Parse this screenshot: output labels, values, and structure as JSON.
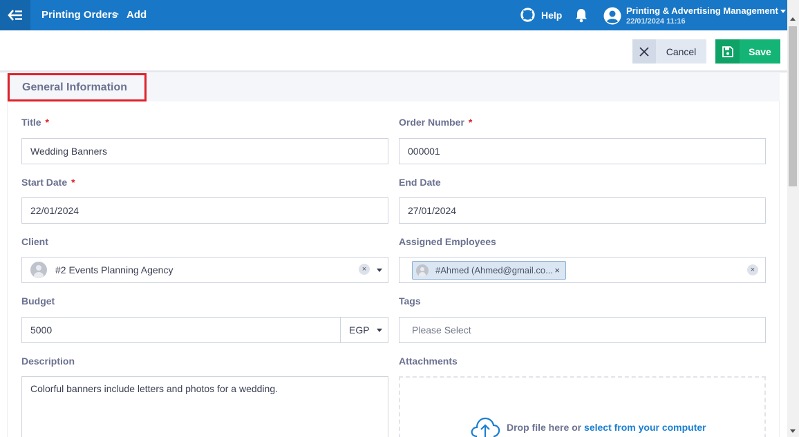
{
  "header": {
    "breadcrumb": [
      "Printing Orders",
      "Add"
    ],
    "breadcrumb_separator": ">",
    "help_label": "Help",
    "user_name": "Printing & Advertising Management",
    "user_datetime": "22/01/2024 11:16"
  },
  "actions": {
    "cancel_label": "Cancel",
    "save_label": "Save"
  },
  "section": {
    "title": "General Information"
  },
  "form": {
    "required_mark": "*",
    "title": {
      "label": "Title",
      "value": "Wedding Banners"
    },
    "order_number": {
      "label": "Order Number",
      "value": "000001"
    },
    "start_date": {
      "label": "Start Date",
      "value": "22/01/2024"
    },
    "end_date": {
      "label": "End Date",
      "value": "27/01/2024"
    },
    "client": {
      "label": "Client",
      "value": "#2 Events Planning Agency"
    },
    "assigned_employees": {
      "label": "Assigned Employees",
      "chips": [
        "#Ahmed (Ahmed@gmail.co..."
      ]
    },
    "budget": {
      "label": "Budget",
      "value": "5000",
      "currency": "EGP"
    },
    "tags": {
      "label": "Tags",
      "placeholder": "Please Select"
    },
    "description": {
      "label": "Description",
      "value": "Colorful banners include letters and photos for a wedding."
    },
    "attachments": {
      "label": "Attachments",
      "drop_text": "Drop file here or",
      "drop_link": "select from your computer"
    }
  },
  "colors": {
    "topbar": "#1877c6",
    "save": "#13b475",
    "required": "#e0202a",
    "link": "#1a7fd1"
  },
  "icons": [
    "back-arrow-icon",
    "lifebuoy-icon",
    "bell-icon",
    "user-avatar-icon",
    "close-icon",
    "save-icon",
    "person-icon",
    "cloud-upload-icon"
  ]
}
